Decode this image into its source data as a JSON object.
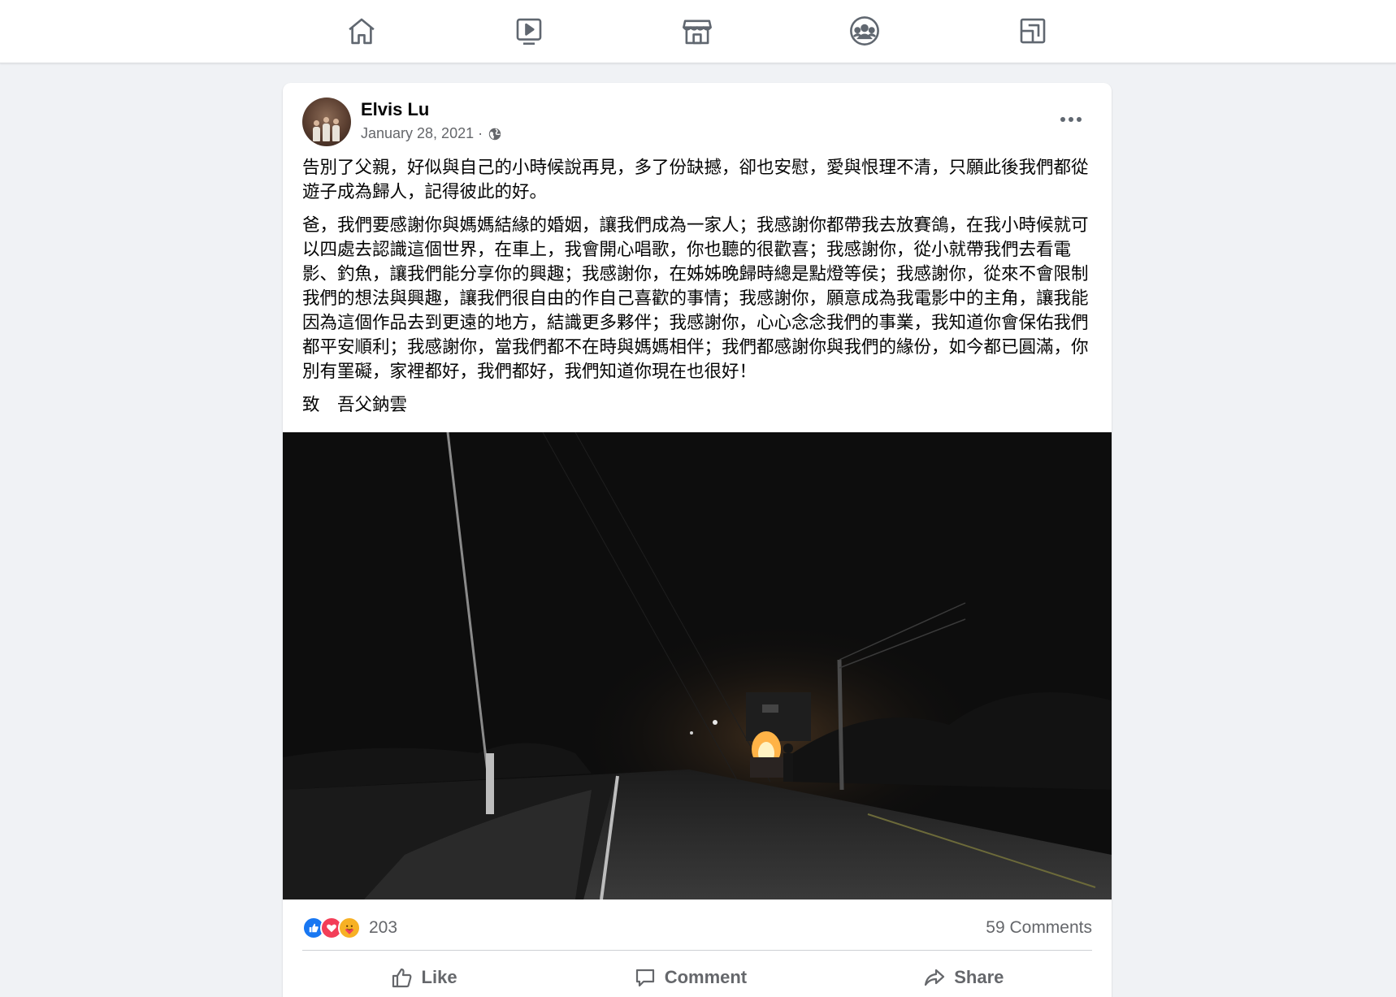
{
  "nav": {
    "items": [
      {
        "name": "home",
        "icon": "home-icon"
      },
      {
        "name": "watch",
        "icon": "video-play-icon"
      },
      {
        "name": "marketplace",
        "icon": "storefront-icon"
      },
      {
        "name": "groups",
        "icon": "groups-icon"
      },
      {
        "name": "gaming",
        "icon": "gaming-icon"
      }
    ]
  },
  "post": {
    "author": "Elvis Lu",
    "date": "January 28, 2021 ·",
    "privacy_icon": "globe-icon",
    "paragraphs": [
      "告別了父親，好似與自己的小時候說再見，多了份缺撼，卻也安慰，愛與恨理不清，只願此後我們都從遊子成為歸人，記得彼此的好。",
      "爸，我們要感謝你與媽媽結緣的婚姻，讓我們成為一家人；我感謝你都帶我去放賽鴿，在我小時候就可以四處去認識這個世界，在車上，我會開心唱歌，你也聽的很歡喜；我感謝你，從小就帶我們去看電影、釣魚，讓我們能分享你的興趣；我感謝你，在姊姊晚歸時總是點燈等侯；我感謝你，從來不會限制我們的想法與興趣，讓我們很自由的作自己喜歡的事情；我感謝你，願意成為我電影中的主角，讓我能因為這個作品去到更遠的地方，結識更多夥伴；我感謝你，心心念念我們的事業，我知道你會保佑我們都平安順利；我感謝你，當我們都不在時與媽媽相伴；我們都感謝你與我們的緣份，如今都已圓滿，你別有罣礙，家裡都好，我們都好，我們知道你現在也很好！",
      "致　吾父鈉雲"
    ],
    "reaction_count": "203",
    "comments_label": "59 Comments",
    "actions": {
      "like": "Like",
      "comment": "Comment",
      "share": "Share"
    },
    "colors": {
      "like": "#1877f2",
      "love": "#f33e58",
      "care": "#f7b125",
      "muted_text": "#65676b"
    }
  }
}
